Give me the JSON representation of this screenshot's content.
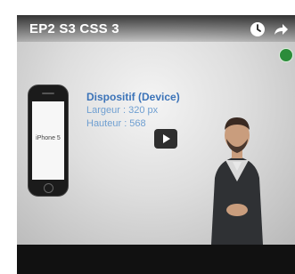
{
  "video": {
    "title": "EP2 S3 CSS 3",
    "icons": [
      "clock-icon",
      "share-icon",
      "play-icon"
    ]
  },
  "slide": {
    "heading": "Dispositif (Device)",
    "line1": "Largeur : 320 px",
    "line2": "Hauteur : 568"
  },
  "phone": {
    "label": "iPhone 5"
  },
  "colors": {
    "heading": "#3b73b8",
    "text": "#6f9fd1",
    "badge": "#2c8c3a"
  }
}
